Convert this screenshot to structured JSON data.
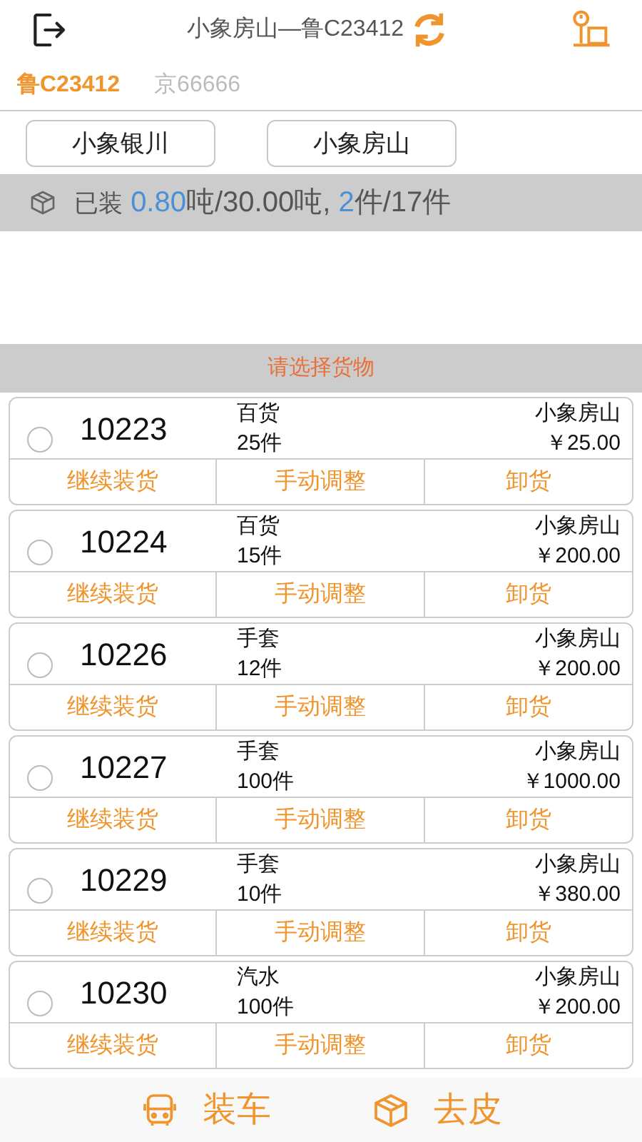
{
  "header": {
    "title": "小象房山—鲁C23412"
  },
  "vehicle_tabs": [
    {
      "label": "鲁C23412",
      "selected": true
    },
    {
      "label": "京66666",
      "selected": false
    }
  ],
  "stations": [
    "小象银川",
    "小象房山"
  ],
  "load_summary": {
    "label": "已装",
    "loaded_weight": "0.80",
    "weight_rest": "吨/30.00吨,",
    "loaded_count": "2",
    "count_rest": "件/17件"
  },
  "section_title": "请选择货物",
  "cargo": [
    {
      "id": "10223",
      "type": "百货",
      "count": "25件",
      "station": "小象房山",
      "price": "￥25.00",
      "selected": false,
      "actions": [
        "继续装货",
        "手动调整",
        "卸货"
      ]
    },
    {
      "id": "10224",
      "type": "百货",
      "count": "15件",
      "station": "小象房山",
      "price": "￥200.00",
      "selected": false,
      "actions": [
        "继续装货",
        "手动调整",
        "卸货"
      ]
    },
    {
      "id": "10226",
      "type": "手套",
      "count": "12件",
      "station": "小象房山",
      "price": "￥200.00",
      "selected": false,
      "actions": [
        "继续装货",
        "手动调整",
        "卸货"
      ]
    },
    {
      "id": "10227",
      "type": "手套",
      "count": "100件",
      "station": "小象房山",
      "price": "￥1000.00",
      "selected": false,
      "actions": [
        "继续装货",
        "手动调整",
        "卸货"
      ]
    },
    {
      "id": "10229",
      "type": "手套",
      "count": "10件",
      "station": "小象房山",
      "price": "￥380.00",
      "selected": false,
      "actions": [
        "继续装货",
        "手动调整",
        "卸货"
      ]
    },
    {
      "id": "10230",
      "type": "汽水",
      "count": "100件",
      "station": "小象房山",
      "price": "￥200.00",
      "selected": false,
      "actions": [
        "继续装货",
        "手动调整",
        "卸货"
      ]
    }
  ],
  "bottom_actions": [
    {
      "kind": "truck",
      "label": "装车"
    },
    {
      "kind": "box",
      "label": "去皮"
    }
  ]
}
